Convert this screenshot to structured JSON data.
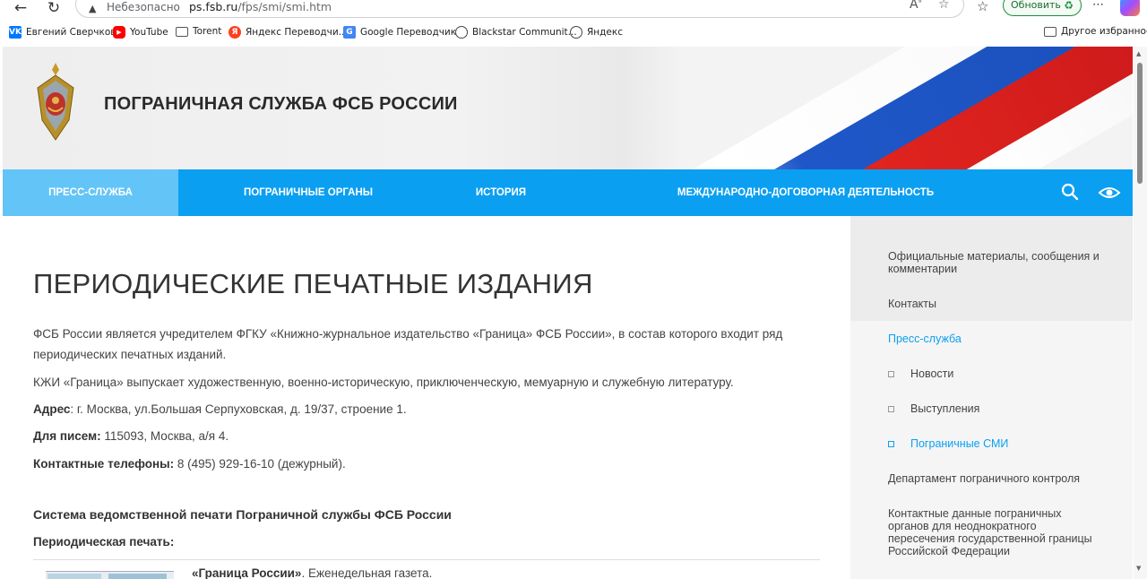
{
  "browser": {
    "insecure_label": "Небезопасно",
    "url_host": "ps.fsb.ru",
    "url_path": "/fps/smi/smi.htm",
    "update_label": "Обновить",
    "bookmarks": [
      {
        "icon": "vk-icon",
        "label": "Евгений Сверчков"
      },
      {
        "icon": "youtube-icon",
        "label": "YouTube"
      },
      {
        "icon": "folder-icon",
        "label": "Torent"
      },
      {
        "icon": "yandex-translate-icon",
        "label": "Яндекс Переводчи..."
      },
      {
        "icon": "google-translate-icon",
        "label": "Google Переводчик"
      },
      {
        "icon": "globe-icon",
        "label": "Blackstar Communit..."
      },
      {
        "icon": "globe-icon",
        "label": "Яндекс"
      }
    ],
    "other_bookmarks_label": "Другое избранное"
  },
  "header": {
    "title": "ПОГРАНИЧНАЯ СЛУЖБА ФСБ РОССИИ",
    "emblem": "fsb-emblem-icon"
  },
  "nav": {
    "items": [
      "ПРЕСС-СЛУЖБА",
      "ПОГРАНИЧНЫЕ ОРГАНЫ",
      "ИСТОРИЯ",
      "МЕЖДУНАРОДНО-ДОГОВОРНАЯ ДЕЯТЕЛЬНОСТЬ"
    ],
    "active_index": 0,
    "color": "#0b9ff1",
    "active_color": "#63c4f7"
  },
  "main": {
    "title": "ПЕРИОДИЧЕСКИЕ ПЕЧАТНЫЕ ИЗДАНИЯ",
    "para1_line1": "ФСБ России является учредителем ФГКУ «Книжно-журнальное издательство «Граница» ФСБ России», в состав которого входит ряд",
    "para1_line2": "периодических печатных изданий.",
    "para2": "КЖИ  «Граница» выпускает художественную, военно-историческую, приключенческую, мемуарную и служебную литературу.",
    "address_label": "Адрес",
    "address_value": ": г. Москва, ул.Большая Серпуховская, д. 19/37, строение 1.",
    "mail_label": "Для писем:",
    "mail_value": " 115093, Москва, а/я 4.",
    "phones_label": "Контактные телефоны:",
    "phones_value": " 8 (495) 929-16-10 (дежурный).",
    "subheading": "Система ведомственной печати Пограничной службы ФСБ России",
    "periodic_label": "Периодическая печать:",
    "item_title": "«Граница России»",
    "item_desc": ". Еженедельная газета."
  },
  "sidebar": {
    "items": [
      "Официальные материалы, сообщения и комментарии",
      "Контакты",
      "Пресс-служба"
    ],
    "subitems": [
      "Новости",
      "Выступления",
      "Пограничные СМИ"
    ],
    "items_after": [
      "Департамент пограничного контроля",
      "Контактные данные пограничных органов для неоднократного пересечения государственной границы Российской Федерации"
    ]
  }
}
